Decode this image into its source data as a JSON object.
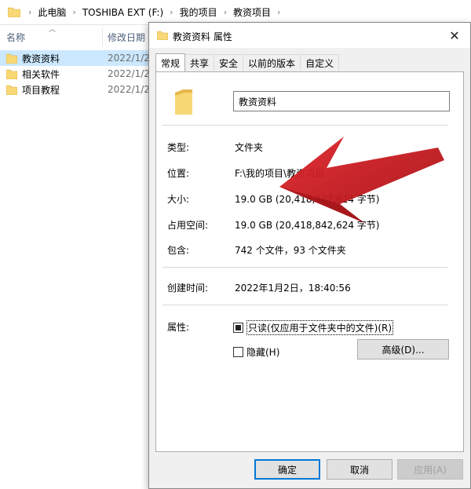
{
  "address": {
    "crumbs": [
      "此电脑",
      "TOSHIBA EXT (F:)",
      "我的项目",
      "教资项目"
    ],
    "sep": "›"
  },
  "columns": {
    "name": "名称",
    "date": "修改日期"
  },
  "files": [
    {
      "name": "教资资料",
      "date": "2022/1/2",
      "selected": true
    },
    {
      "name": "相关软件",
      "date": "2022/1/2",
      "selected": false
    },
    {
      "name": "项目教程",
      "date": "2022/1/2",
      "selected": false
    }
  ],
  "dialog": {
    "title": "教资资料 属性",
    "tabs": [
      "常规",
      "共享",
      "安全",
      "以前的版本",
      "自定义"
    ],
    "folder_name": "教资资料",
    "props": {
      "type_label": "类型:",
      "type_value": "文件夹",
      "location_label": "位置:",
      "location_value": "F:\\我的项目\\教资项目",
      "size_label": "大小:",
      "size_value": "19.0 GB (20,418,842,624 字节)",
      "disk_label": "占用空间:",
      "disk_value": "19.0 GB (20,418,842,624 字节)",
      "contains_label": "包含:",
      "contains_value": "742 个文件，93 个文件夹",
      "created_label": "创建时间:",
      "created_value": "2022年1月2日，18:40:56",
      "attrs_label": "属性:"
    },
    "readonly_label": "只读(仅应用于文件夹中的文件)(R)",
    "hidden_label": "隐藏(H)",
    "advanced_label": "高级(D)...",
    "ok_label": "确定",
    "cancel_label": "取消",
    "apply_label": "应用(A)"
  },
  "colors": {
    "accent": "#0078d7",
    "folder": "#f8d775",
    "arrow": "#c8151b"
  }
}
